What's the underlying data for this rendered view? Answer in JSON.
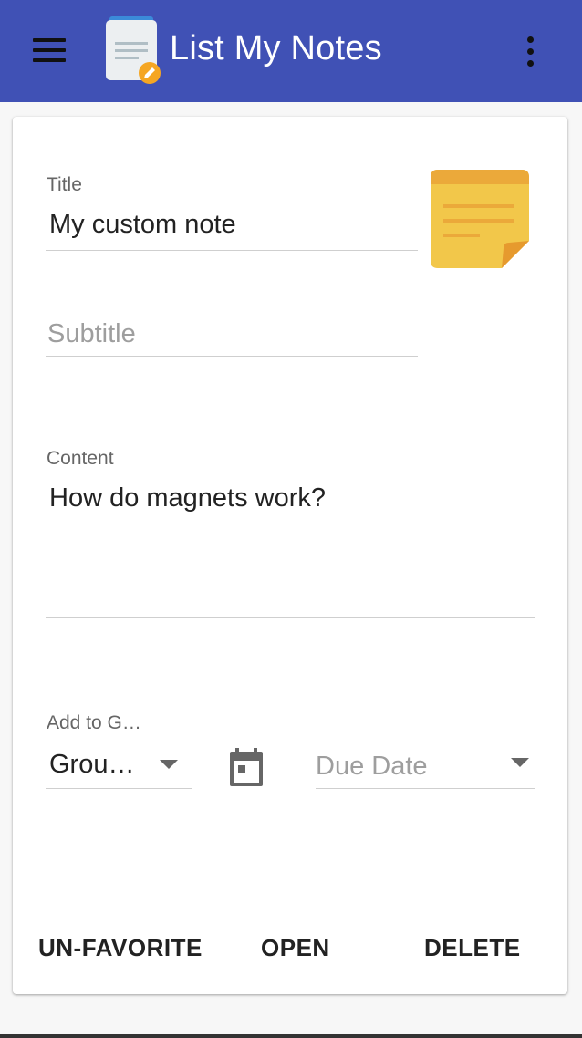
{
  "app": {
    "title": "List My Notes",
    "primary_color": "#4051b5"
  },
  "form": {
    "title": {
      "label": "Title",
      "value": "My custom note"
    },
    "subtitle": {
      "placeholder": "Subtitle"
    },
    "content": {
      "label": "Content",
      "value": "How do magnets work?"
    },
    "group": {
      "label": "Add to G…",
      "value": "Grou…"
    },
    "due_date": {
      "placeholder": "Due Date"
    }
  },
  "actions": {
    "unfavorite": "UN-FAVORITE",
    "open": "OPEN",
    "delete": "DELETE"
  },
  "icons": {
    "menu": "hamburger-menu-icon",
    "logo": "notes-app-icon",
    "overflow": "more-vert-icon",
    "note": "sticky-note-icon",
    "calendar": "calendar-icon"
  }
}
